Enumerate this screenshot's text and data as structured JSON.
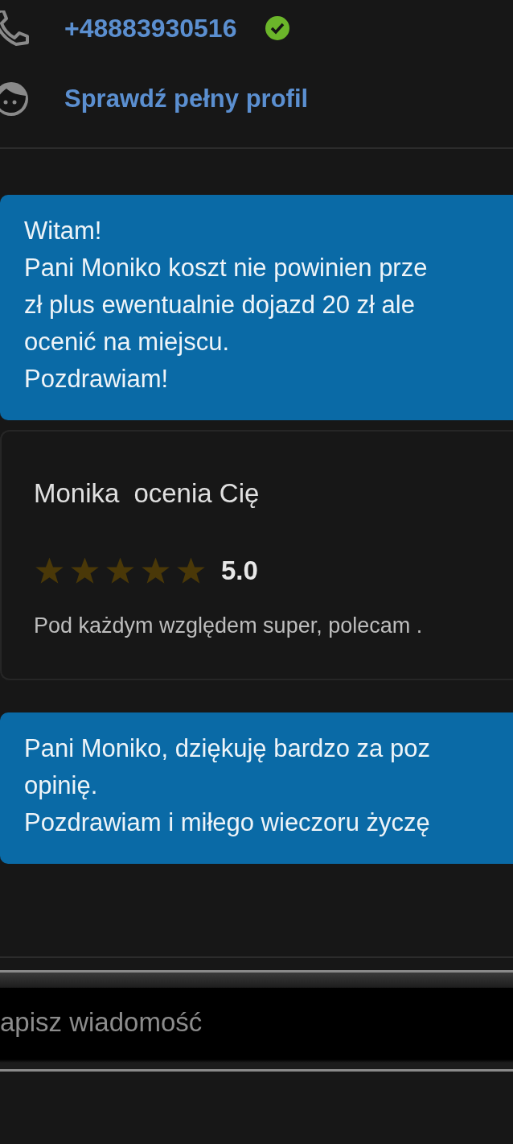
{
  "contact": {
    "phone": "+48883930516",
    "phone_verified": true,
    "profile_link": "Sprawdź pełny profil"
  },
  "messages": [
    {
      "kind": "sent",
      "lines": [
        "Witam!",
        "Pani Moniko koszt nie powinien prze",
        "zł plus ewentualnie dojazd 20 zł ale",
        "ocenić na miejscu.",
        "Pozdrawiam!"
      ]
    },
    {
      "kind": "review",
      "reviewer": "Monika",
      "title": "ocenia Cię",
      "stars": 5,
      "rating": "5.0",
      "comment": "Pod każdym względem super, polecam ."
    },
    {
      "kind": "sent",
      "lines": [
        "Pani Moniko, dziękuję bardzo za poz",
        "opinię.",
        "Pozdrawiam i miłego wieczoru życzę"
      ]
    }
  ],
  "composer": {
    "placeholder": "apisz wiadomość"
  }
}
